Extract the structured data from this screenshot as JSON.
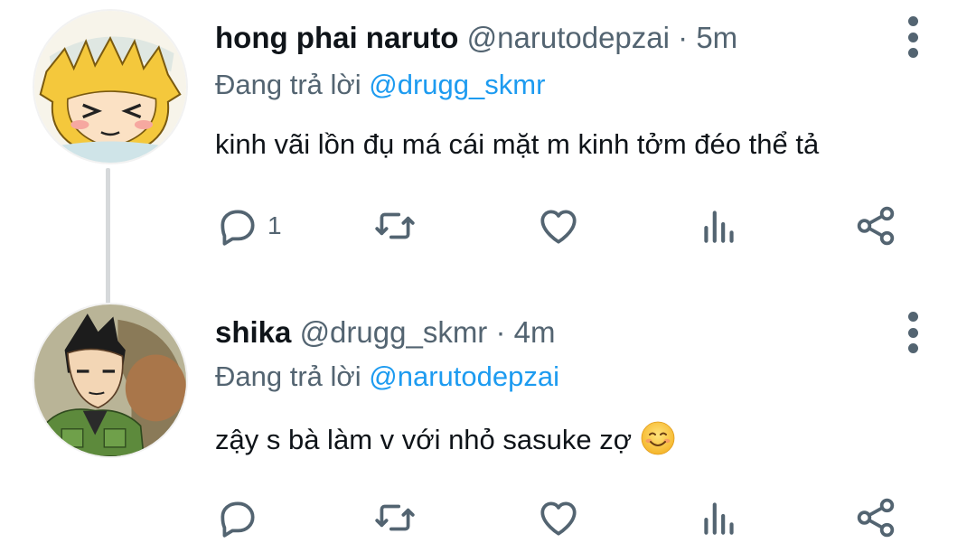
{
  "tweets": [
    {
      "name": "hong phai naruto",
      "handle": "@narutodepzai",
      "separator": "·",
      "time": "5m",
      "reply_prefix": "Đang trả lời",
      "reply_to": "@drugg_skmr",
      "text": "kinh vãi lồn đụ má cái mặt m kinh tởm đéo thể tả",
      "reply_count": "1",
      "avatar_icon": "naruto-avatar"
    },
    {
      "name": "shika",
      "handle": "@drugg_skmr",
      "separator": "·",
      "time": "4m",
      "reply_prefix": "Đang trả lời",
      "reply_to": "@narutodepzai",
      "text": "zậy s bà làm v với nhỏ sasuke zợ",
      "emoji": "smiling-face-emoji",
      "reply_count": "",
      "avatar_icon": "shikamaru-avatar"
    }
  ],
  "colors": {
    "name": "#0f1419",
    "meta": "#536471",
    "link": "#1d9bf0",
    "thread_line": "#d6d9db"
  }
}
